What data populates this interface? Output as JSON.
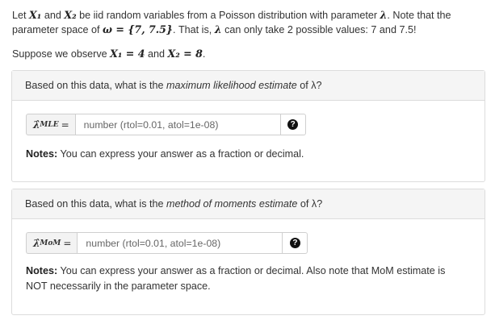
{
  "intro": {
    "line1_pre": "Let",
    "x1": "X₁",
    "and": "and",
    "x2": "X₂",
    "line1_mid": "be iid random variables from a Poisson distribution with parameter",
    "lambda": "λ",
    "line1_post": ". Note that the parameter space of",
    "omega": "ω = {7, 7.5}",
    "line2_post": ". That is,",
    "line2_end": "can only take 2 possible values: 7 and 7.5!"
  },
  "observe": {
    "pre": "Suppose we observe",
    "x1_eq": "X₁ = 4",
    "and": "and",
    "x2_eq": "X₂ = 8",
    "end": "."
  },
  "q1": {
    "question_pre": "Based on this data, what is the",
    "question_em": "maximum likelihood estimate",
    "question_post": "of λ?",
    "addon_symbol": "λ̂",
    "addon_sub": "MLE",
    "addon_eq": "=",
    "placeholder": "number (rtol=0.01, atol=1e-08)",
    "value": "",
    "help_icon": "question-circle",
    "notes_label": "Notes:",
    "notes_text": "You can express your answer as a fraction or decimal."
  },
  "q2": {
    "question_pre": "Based on this data, what is the",
    "question_em": "method of moments estimate",
    "question_post": "of λ?",
    "addon_symbol": "λ̂",
    "addon_sub": "MoM",
    "addon_eq": "=",
    "placeholder": "number (rtol=0.01, atol=1e-08)",
    "value": "",
    "help_icon": "question-circle",
    "notes_label": "Notes:",
    "notes_text": "You can express your answer as a fraction or decimal. Also note that MoM estimate is NOT necessarily in the parameter space."
  }
}
